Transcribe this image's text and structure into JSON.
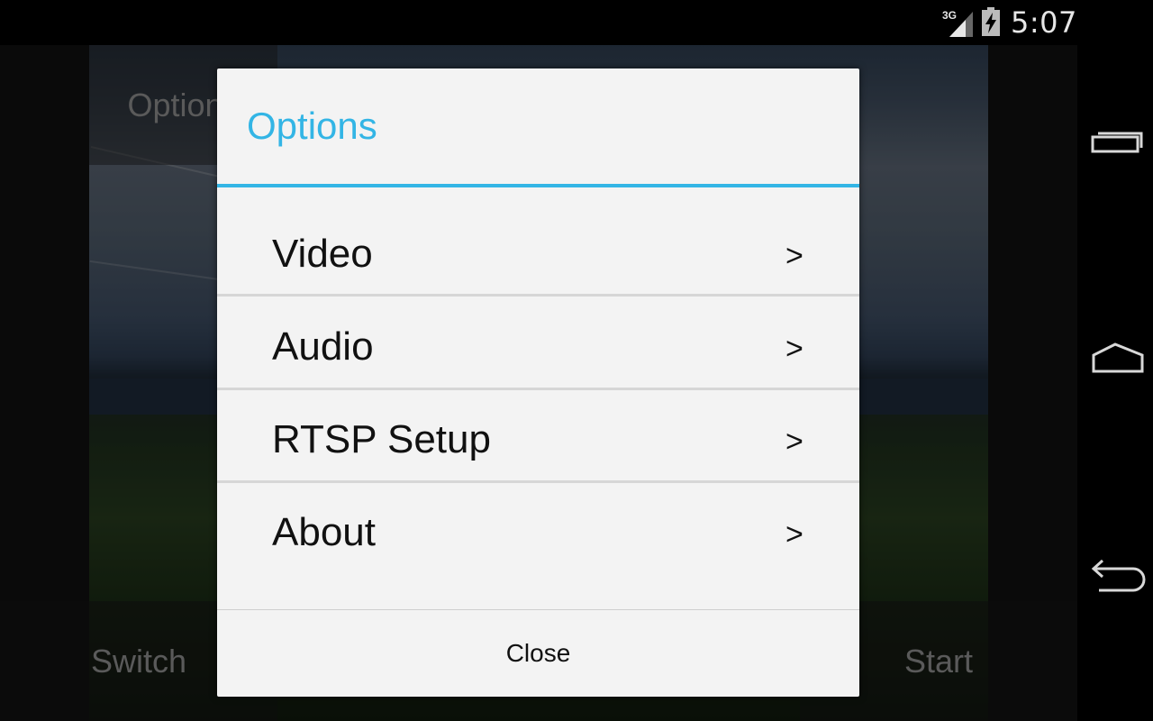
{
  "status_bar": {
    "network": "3G",
    "time": "5:07"
  },
  "background_app": {
    "options_label": "Options",
    "switch_label": "Switch",
    "start_label": "Start"
  },
  "dialog": {
    "title": "Options",
    "items": [
      {
        "label": "Video",
        "chevron": ">"
      },
      {
        "label": "Audio",
        "chevron": ">"
      },
      {
        "label": "RTSP Setup",
        "chevron": ">"
      },
      {
        "label": "About",
        "chevron": ">"
      }
    ],
    "close_label": "Close"
  },
  "colors": {
    "accent": "#33b5e5",
    "dialog_bg": "#f3f3f3"
  },
  "icons": {
    "signal": "signal-3g-icon",
    "battery": "battery-charging-icon",
    "recent": "recent-apps-icon",
    "home": "home-icon",
    "back": "back-icon"
  }
}
